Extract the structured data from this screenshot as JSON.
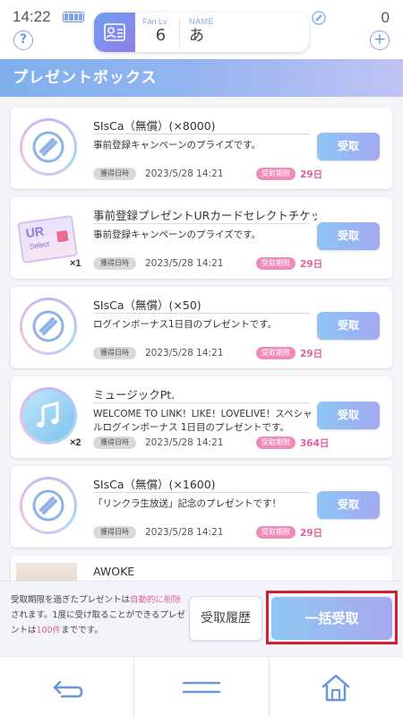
{
  "status": {
    "time": "14:22"
  },
  "header": {
    "fan_label": "Fan Lv.",
    "fan_level": "6",
    "name_label": "NAME",
    "name_value": "あ",
    "currency_count": "0",
    "help_icon_text": "?",
    "plus_icon_text": "+"
  },
  "page": {
    "title": "プレゼントボックス"
  },
  "items": [
    {
      "title": "SIsCa（無償）(×8000)",
      "desc": "事前登録キャンペーンのプライズです。",
      "acquired_label": "獲得日時",
      "date": "2023/5/28 14:21",
      "deadline_label": "受取期限",
      "days": "29日",
      "button": "受取",
      "thumb": "sisca-icon",
      "qty": ""
    },
    {
      "title": "事前登録プレゼントURカードセレクトチケット",
      "desc": "事前登録キャンペーンのプライズです。",
      "acquired_label": "獲得日時",
      "date": "2023/5/28 14:21",
      "deadline_label": "受取期限",
      "days": "29日",
      "button": "受取",
      "thumb": "ur-ticket-icon",
      "qty": "×1",
      "thumb_text_1": "UR",
      "thumb_text_2": "Select"
    },
    {
      "title": "SIsCa（無償）(×50)",
      "desc": "ログインボーナス1日目のプレゼントです。",
      "acquired_label": "獲得日時",
      "date": "2023/5/28 14:21",
      "deadline_label": "受取期限",
      "days": "29日",
      "button": "受取",
      "thumb": "sisca-icon",
      "qty": ""
    },
    {
      "title": "ミュージックPt.",
      "desc": "WELCOME TO LINK！LIKE！LOVELIVE！スペシャルログインボーナス 1日目のプレゼントです。",
      "acquired_label": "獲得日時",
      "date": "2023/5/28 14:21",
      "deadline_label": "受取期限",
      "days": "364日",
      "button": "受取",
      "thumb": "music-note-icon",
      "qty": "×2"
    },
    {
      "title": "SIsCa（無償）(×1600)",
      "desc": "「リンクラ生放送」記念のプレゼントです！",
      "acquired_label": "獲得日時",
      "date": "2023/5/28 14:21",
      "deadline_label": "受取期限",
      "days": "29日",
      "button": "受取",
      "thumb": "sisca-icon",
      "qty": ""
    },
    {
      "title": "AWOKE",
      "desc": "",
      "acquired_label": "",
      "date": "",
      "deadline_label": "",
      "days": "",
      "button": "",
      "thumb": "card-photo",
      "qty": ""
    }
  ],
  "footer": {
    "notice_1": "受取期限を過ぎたプレゼントは",
    "notice_hl_1": "自動的に削除",
    "notice_2": "されます。1度に受け取ることができるプレゼントは",
    "notice_hl_2": "100件",
    "notice_3": "までです。",
    "history_button": "受取履歴",
    "bulk_button": "一括受取"
  },
  "nav": [
    "back-icon",
    "menu-icon",
    "home-icon"
  ],
  "colors": {
    "accent_blue": "#8ec5f3",
    "accent_purple": "#a2a9f2",
    "pink": "#f08ab8",
    "highlight_red": "#d1202e"
  }
}
